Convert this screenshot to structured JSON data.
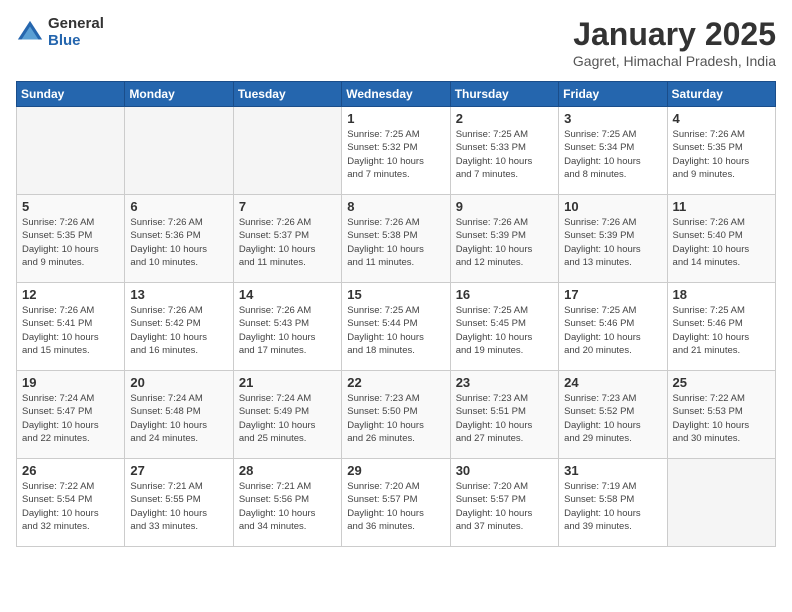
{
  "logo": {
    "general": "General",
    "blue": "Blue"
  },
  "header": {
    "title": "January 2025",
    "subtitle": "Gagret, Himachal Pradesh, India"
  },
  "weekdays": [
    "Sunday",
    "Monday",
    "Tuesday",
    "Wednesday",
    "Thursday",
    "Friday",
    "Saturday"
  ],
  "weeks": [
    [
      {
        "day": "",
        "info": ""
      },
      {
        "day": "",
        "info": ""
      },
      {
        "day": "",
        "info": ""
      },
      {
        "day": "1",
        "info": "Sunrise: 7:25 AM\nSunset: 5:32 PM\nDaylight: 10 hours\nand 7 minutes."
      },
      {
        "day": "2",
        "info": "Sunrise: 7:25 AM\nSunset: 5:33 PM\nDaylight: 10 hours\nand 7 minutes."
      },
      {
        "day": "3",
        "info": "Sunrise: 7:25 AM\nSunset: 5:34 PM\nDaylight: 10 hours\nand 8 minutes."
      },
      {
        "day": "4",
        "info": "Sunrise: 7:26 AM\nSunset: 5:35 PM\nDaylight: 10 hours\nand 9 minutes."
      }
    ],
    [
      {
        "day": "5",
        "info": "Sunrise: 7:26 AM\nSunset: 5:35 PM\nDaylight: 10 hours\nand 9 minutes."
      },
      {
        "day": "6",
        "info": "Sunrise: 7:26 AM\nSunset: 5:36 PM\nDaylight: 10 hours\nand 10 minutes."
      },
      {
        "day": "7",
        "info": "Sunrise: 7:26 AM\nSunset: 5:37 PM\nDaylight: 10 hours\nand 11 minutes."
      },
      {
        "day": "8",
        "info": "Sunrise: 7:26 AM\nSunset: 5:38 PM\nDaylight: 10 hours\nand 11 minutes."
      },
      {
        "day": "9",
        "info": "Sunrise: 7:26 AM\nSunset: 5:39 PM\nDaylight: 10 hours\nand 12 minutes."
      },
      {
        "day": "10",
        "info": "Sunrise: 7:26 AM\nSunset: 5:39 PM\nDaylight: 10 hours\nand 13 minutes."
      },
      {
        "day": "11",
        "info": "Sunrise: 7:26 AM\nSunset: 5:40 PM\nDaylight: 10 hours\nand 14 minutes."
      }
    ],
    [
      {
        "day": "12",
        "info": "Sunrise: 7:26 AM\nSunset: 5:41 PM\nDaylight: 10 hours\nand 15 minutes."
      },
      {
        "day": "13",
        "info": "Sunrise: 7:26 AM\nSunset: 5:42 PM\nDaylight: 10 hours\nand 16 minutes."
      },
      {
        "day": "14",
        "info": "Sunrise: 7:26 AM\nSunset: 5:43 PM\nDaylight: 10 hours\nand 17 minutes."
      },
      {
        "day": "15",
        "info": "Sunrise: 7:25 AM\nSunset: 5:44 PM\nDaylight: 10 hours\nand 18 minutes."
      },
      {
        "day": "16",
        "info": "Sunrise: 7:25 AM\nSunset: 5:45 PM\nDaylight: 10 hours\nand 19 minutes."
      },
      {
        "day": "17",
        "info": "Sunrise: 7:25 AM\nSunset: 5:46 PM\nDaylight: 10 hours\nand 20 minutes."
      },
      {
        "day": "18",
        "info": "Sunrise: 7:25 AM\nSunset: 5:46 PM\nDaylight: 10 hours\nand 21 minutes."
      }
    ],
    [
      {
        "day": "19",
        "info": "Sunrise: 7:24 AM\nSunset: 5:47 PM\nDaylight: 10 hours\nand 22 minutes."
      },
      {
        "day": "20",
        "info": "Sunrise: 7:24 AM\nSunset: 5:48 PM\nDaylight: 10 hours\nand 24 minutes."
      },
      {
        "day": "21",
        "info": "Sunrise: 7:24 AM\nSunset: 5:49 PM\nDaylight: 10 hours\nand 25 minutes."
      },
      {
        "day": "22",
        "info": "Sunrise: 7:23 AM\nSunset: 5:50 PM\nDaylight: 10 hours\nand 26 minutes."
      },
      {
        "day": "23",
        "info": "Sunrise: 7:23 AM\nSunset: 5:51 PM\nDaylight: 10 hours\nand 27 minutes."
      },
      {
        "day": "24",
        "info": "Sunrise: 7:23 AM\nSunset: 5:52 PM\nDaylight: 10 hours\nand 29 minutes."
      },
      {
        "day": "25",
        "info": "Sunrise: 7:22 AM\nSunset: 5:53 PM\nDaylight: 10 hours\nand 30 minutes."
      }
    ],
    [
      {
        "day": "26",
        "info": "Sunrise: 7:22 AM\nSunset: 5:54 PM\nDaylight: 10 hours\nand 32 minutes."
      },
      {
        "day": "27",
        "info": "Sunrise: 7:21 AM\nSunset: 5:55 PM\nDaylight: 10 hours\nand 33 minutes."
      },
      {
        "day": "28",
        "info": "Sunrise: 7:21 AM\nSunset: 5:56 PM\nDaylight: 10 hours\nand 34 minutes."
      },
      {
        "day": "29",
        "info": "Sunrise: 7:20 AM\nSunset: 5:57 PM\nDaylight: 10 hours\nand 36 minutes."
      },
      {
        "day": "30",
        "info": "Sunrise: 7:20 AM\nSunset: 5:57 PM\nDaylight: 10 hours\nand 37 minutes."
      },
      {
        "day": "31",
        "info": "Sunrise: 7:19 AM\nSunset: 5:58 PM\nDaylight: 10 hours\nand 39 minutes."
      },
      {
        "day": "",
        "info": ""
      }
    ]
  ]
}
